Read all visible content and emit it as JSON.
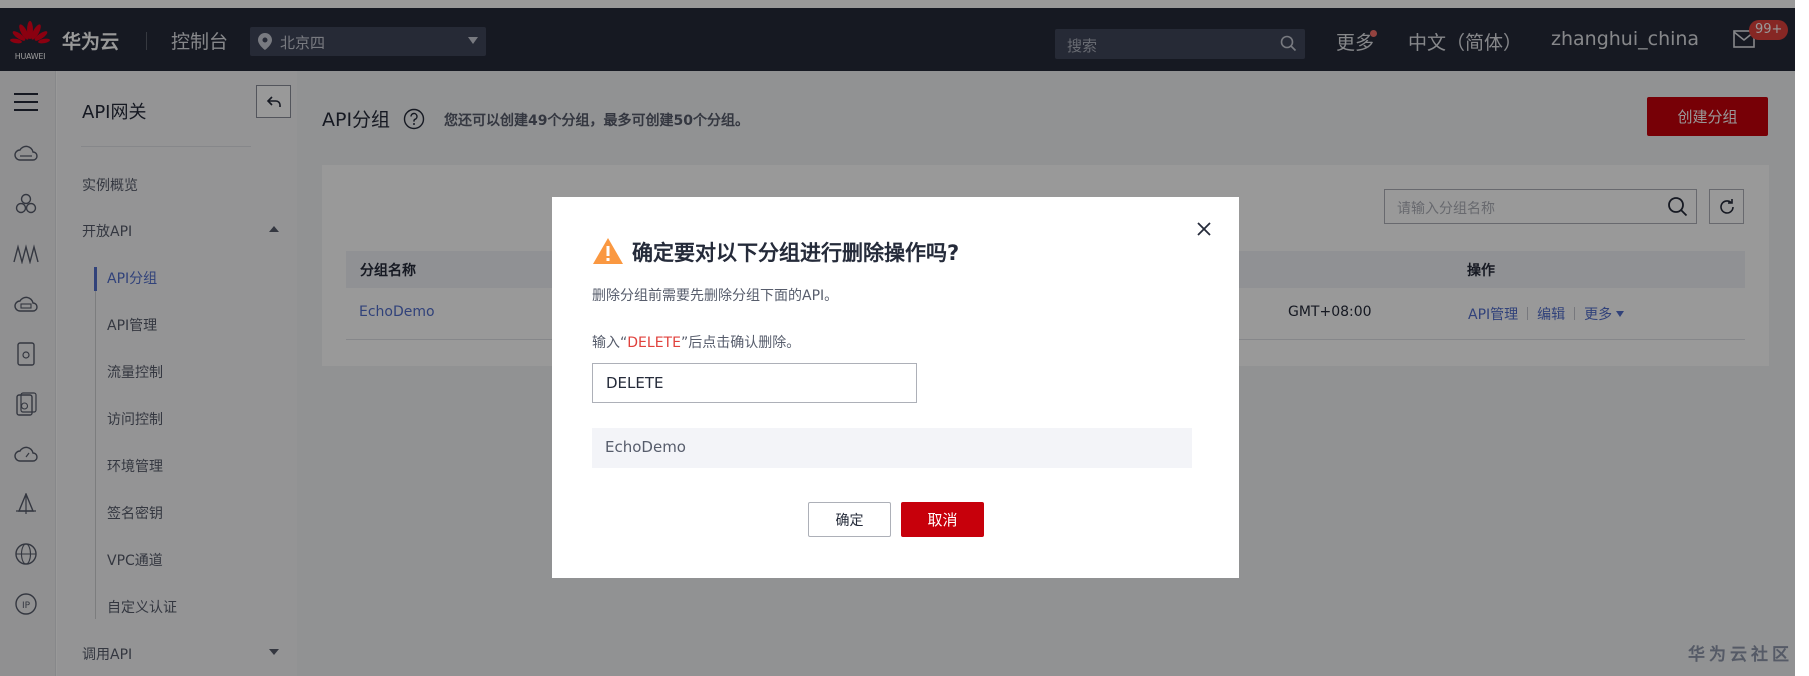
{
  "header": {
    "logo_text": "HUAWEI",
    "brand": "华为云",
    "console": "控制台",
    "region": "北京四",
    "search_placeholder": "搜索",
    "more": "更多",
    "language": "中文（简体）",
    "user": "zhanghui_china",
    "badge": "99+"
  },
  "sidebar": {
    "title": "API网关",
    "items": {
      "overview": "实例概览",
      "open_api": "开放API",
      "call_api": "调用API"
    },
    "sub_items": [
      "API分组",
      "API管理",
      "流量控制",
      "访问控制",
      "环境管理",
      "签名密钥",
      "VPC通道",
      "自定义认证"
    ]
  },
  "main": {
    "title": "API分组",
    "hint": "您还可以创建49个分组，最多可创建50个分组。",
    "create_button": "创建分组",
    "search_placeholder": "请输入分组名称",
    "table": {
      "headers": [
        "分组名称",
        "操作"
      ],
      "rows": [
        {
          "name": "EchoDemo",
          "time_suffix": "GMT+08:00",
          "ops": [
            "API管理",
            "编辑",
            "更多"
          ]
        }
      ]
    }
  },
  "dialog": {
    "title": "确定要对以下分组进行删除操作吗?",
    "description": "删除分组前需要先删除分组下面的API。",
    "prompt_prefix": "输入“",
    "prompt_keyword": "DELETE",
    "prompt_suffix": "”后点击确认删除。",
    "input_value": "DELETE",
    "target_group": "EchoDemo",
    "ok_button": "确定",
    "cancel_button": "取消"
  },
  "watermark": "华为云社区",
  "colors": {
    "header_bg": "#252b3a",
    "brand_red": "#c7000b",
    "link_blue": "#526ecc",
    "warning_orange": "#fa9841",
    "keyword_red": "#e0413c"
  },
  "icons": {
    "header": [
      "huawei-logo-icon",
      "location-pin-icon",
      "search-icon",
      "mail-icon"
    ],
    "rail": [
      "menu-icon",
      "cloud-server-icon",
      "cluster-icon",
      "api-wave-icon",
      "database-icon",
      "storage-icon",
      "disk-icon",
      "cloud-speed-icon",
      "mountain-icon",
      "globe-icon",
      "ip-icon"
    ],
    "dialog": [
      "warning-icon",
      "close-icon"
    ]
  }
}
